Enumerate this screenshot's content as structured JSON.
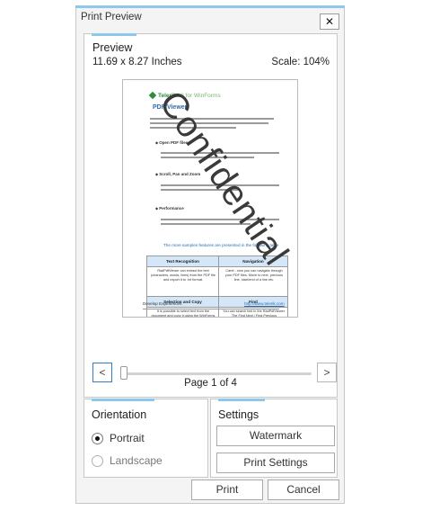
{
  "dialog": {
    "title": "Print Preview",
    "close_glyph": "✕",
    "close_icon": "close-icon"
  },
  "preview": {
    "label": "Preview",
    "page_size": "11.69 x 8.27 Inches",
    "scale": "Scale: 104%",
    "page_indicator": "Page 1 of 4",
    "prev_glyph": "<",
    "next_glyph": ">",
    "document": {
      "logo_brand": "Telerik",
      "logo_suffix": "UI for WinForms",
      "heading": "PDF Viewer",
      "bullets": [
        "Open PDF files",
        "Scroll, Pan and Zoom",
        "Performance"
      ],
      "link_line": "The more samples features are presented in the following table",
      "table": {
        "headers": [
          "Text Recognition",
          "Navigation",
          "Selection and Copy",
          "Find"
        ],
        "cells": [
          "RadPdfViewer can extract the text (characters, words, lines) from the PDF file and export it to .txt format.",
          "Caret - now you can navigate through your PDF files. Move to next, previous line, start/end of a line etc.",
          "It is possible to select text from the document and copy it using the WinForms clipboard.",
          "You can search text in the RadPdfViewer. The Find Next / Find Previous functionality will also enable navigation in the document."
        ]
      },
      "footer_left": "Develop Experiences",
      "footer_right": "http://www.telerik.com"
    },
    "watermark": "Confidential"
  },
  "orientation": {
    "label": "Orientation",
    "options": [
      {
        "label": "Portrait",
        "checked": true
      },
      {
        "label": "Landscape",
        "checked": false
      }
    ]
  },
  "settings": {
    "label": "Settings",
    "watermark_button": "Watermark",
    "print_settings_button": "Print Settings"
  },
  "actions": {
    "print": "Print",
    "cancel": "Cancel"
  },
  "colors": {
    "accent": "#8cc7ee",
    "focus_border": "#2f7fc8"
  }
}
